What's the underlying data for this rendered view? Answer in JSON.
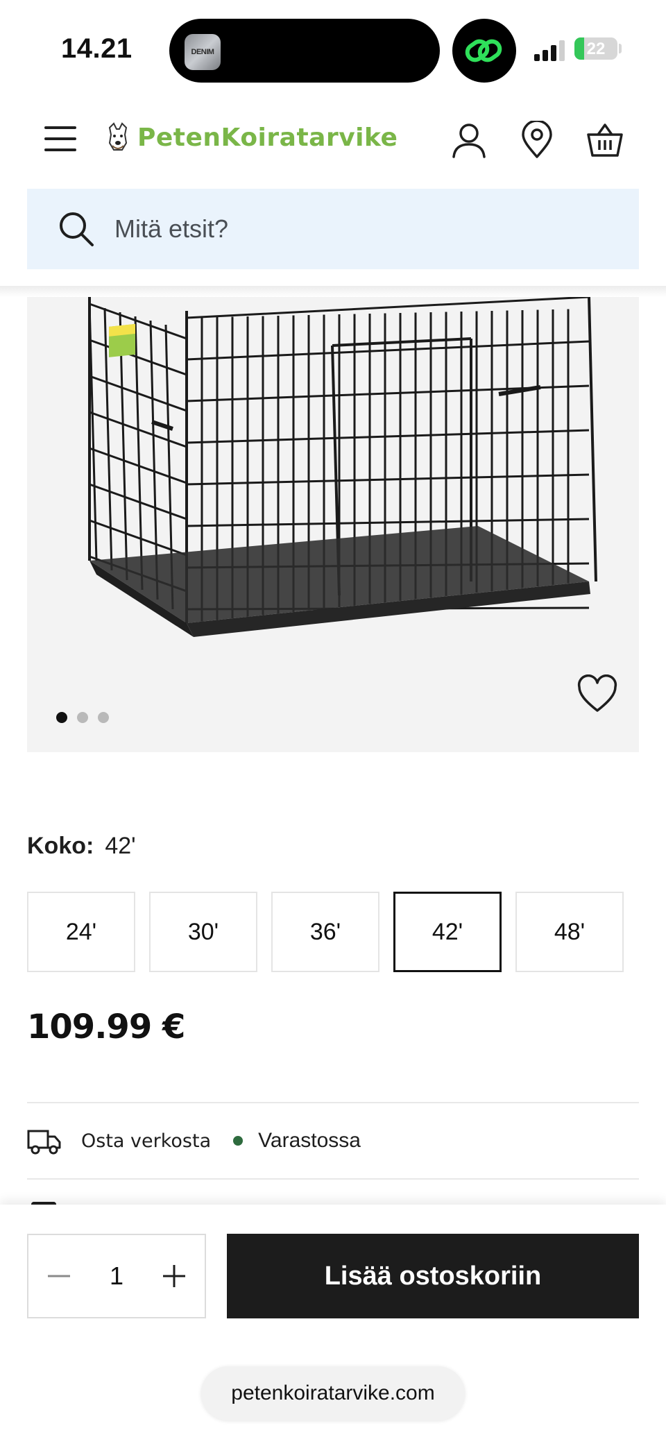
{
  "status_bar": {
    "time": "14.21",
    "island_app_label": "DENIM",
    "battery_level": "22",
    "battery_fraction": 0.22,
    "battery_color": "#34c759"
  },
  "header": {
    "brand": "PetenKoiratarvike",
    "brand_color": "#7ab648",
    "icons": [
      "hamburger-menu-icon",
      "account-icon",
      "store-location-icon",
      "basket-icon"
    ]
  },
  "search": {
    "placeholder": "Mitä etsit?",
    "background_color": "#eaf3fc"
  },
  "gallery": {
    "slide_count": 3,
    "active_slide": 1,
    "favorite_icon": "heart-outline-icon"
  },
  "size": {
    "label": "Koko:",
    "selected": "42'",
    "options": [
      "24'",
      "30'",
      "36'",
      "42'",
      "48'"
    ]
  },
  "price": "109.99 €",
  "availability": {
    "channel": "Osta verkosta",
    "status": "Varastossa",
    "status_color": "#2e6b3e"
  },
  "cart": {
    "quantity": "1",
    "add_to_cart_label": "Lisää ostoskoriin"
  },
  "browser": {
    "url": "petenkoiratarvike.com"
  }
}
